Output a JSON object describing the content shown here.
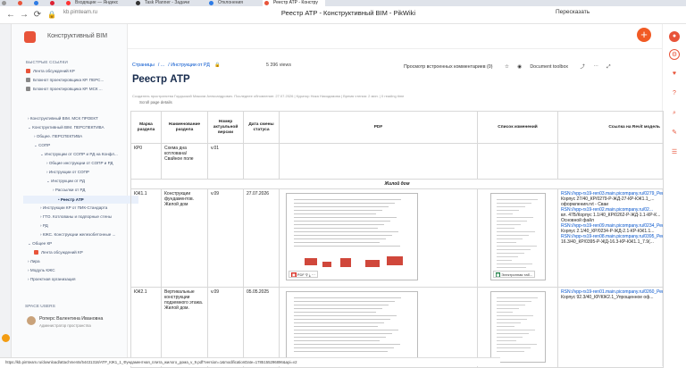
{
  "browser": {
    "tabs": [
      {
        "label": "",
        "color": "#999"
      },
      {
        "label": "",
        "color": "#e8543a"
      },
      {
        "label": "",
        "color": "#2d7be5"
      },
      {
        "label": "",
        "color": "#d23"
      },
      {
        "label": "Входящие — Яндекс",
        "color": "#f33"
      },
      {
        "label": "Task Planner - Задачи",
        "color": "#333"
      },
      {
        "label": "Отклонения",
        "color": "#2d7be5"
      },
      {
        "label": "Реестр АТР - Констру",
        "color": "#e8543a"
      }
    ],
    "url": "kb.pimteam.ru",
    "page_title": "Реестр АТР - Конструктивный BIM - PikWiki",
    "translate": "Пересказать"
  },
  "sidebar": {
    "space_name": "Конструктивный BIM",
    "quick_links_header": "БЫСТРЫЕ ССЫЛКИ",
    "quick_links": [
      "Лента обсуждений КР",
      "Блокнот проектировщика КР. ПЕРС...",
      "Блокнот проектировщика КР. МСК ..."
    ],
    "tree": [
      "Конструктивный BIM. МСК ПРОЕКТ",
      "Конструктивный BIM. ПЕРСПЕКТИВА",
      "Общее. ПЕРСПЕКТИВА",
      "СОПР",
      "Инструкции от СОПР и РД на Конфл...",
      "Общие инструкции от СОПР и РД",
      "Инструкции от СОПР",
      "Инструкции от РД",
      "Рассылки от РД",
      "Реестр АТР",
      "Инструкции КР от ПИК-Стандарта",
      "ГТО. Котлованы и подпорные стены",
      "РД",
      "КЖС. Конструкции железобетонные ...",
      "Общее КР",
      "Лента обсуждений КР",
      "Лира",
      "Модуль КЖС",
      "Проектная организация"
    ],
    "users_header": "SPACE USERS",
    "user_name": "Роперс Валентина Ивановна",
    "user_role": "Администратор пространства"
  },
  "page": {
    "crumbs": [
      "Страницы",
      "...",
      "Инструкции от РД"
    ],
    "views": "5 396 views",
    "toolbar": [
      "Просмотр встроенных комментариев (0)",
      "Document toolbox"
    ],
    "title": "Реестр АТР",
    "meta": "Создатель пространства Гордыский Максим Александрович. Последнее обновление: 27.07.2026 | Куратор Ника Никодимова | Время чтения: 2 мин. | 0 reading time",
    "scroll_link": "Scroll page details"
  },
  "table": {
    "headers": [
      "Марка раздела",
      "Наименование раздела",
      "Номер актуальной версии",
      "Дата смены статуса",
      "PDF",
      "Список изменений",
      "Ссылка на Revit модель"
    ],
    "row0": {
      "mark": "КР0",
      "name": "Схема дна котлована/ Свайное поле",
      "ver": "v.01",
      "date": ""
    },
    "section": "Жилой дом",
    "row1": {
      "mark": "КЖ1.1",
      "name": "Конструкции фундаментов. Жилой дом",
      "ver": "v.09",
      "date": "27.07.2026",
      "pdf_label": "PDF",
      "xls_label": "Электронная таб...",
      "links": [
        {
          "t": "RSN://vpp-rs19-ren03.main.picompany.ru/0279_Рен_Кронш",
          "c": "lnk"
        },
        {
          "t": "Корпус 27/40_КР/0279-Р-ЖД-27-КР-КЖ1.1_...",
          "c": ""
        },
        {
          "t": "оформления.rvt - Сваи",
          "c": ""
        },
        {
          "t": "RSN://vpp-rs19-ren02.main.picompany.ru/02...",
          "c": "lnk"
        },
        {
          "t": "вл. 47Б/Корпус 1.1/40_КР/0262-Р-ЖД-1.1-КР-К...",
          "c": ""
        },
        {
          "t": "Основной файл",
          "c": ""
        },
        {
          "t": "RSN://vpp-rs19-ren09.main.picompany.ru/0234_Рен_...",
          "c": "lnk"
        },
        {
          "t": "Корпус 2.1/40_КР/0234-Р-ЖД-2.1-КР-КЖ1.1...",
          "c": ""
        },
        {
          "t": "RSN://vpp-rs19-ren08.main.picompany.ru/0395_Рен_Головн...",
          "c": "lnk"
        },
        {
          "t": "16.3/40_КР/0395-Р-ЖД-16.3-КР-КЖ1.1_7.9(...",
          "c": ""
        }
      ]
    },
    "row2": {
      "mark": "КЖ2.1",
      "name": "Вертикальные конструкции подземного этажа. Жилой дом.",
      "ver": "v.09",
      "date": "05.05.2025",
      "links": [
        {
          "t": "RSN://vpp-rs19-ren01.main.picompany.ru/0260_Рен_Шмелев...",
          "c": "lnk"
        },
        {
          "t": "Корпус 92.3/40_КР/КЖ2.1_Упрощенное оф...",
          "c": ""
        }
      ]
    }
  },
  "status_url": "https://kb.pimteam.ru/download/attachments/54431318/АТР_КЖ1_1_Фундаментная_плита_жилого_дома_v_9.pdf?version=1&modificationDate=1785155296896&api=v2"
}
